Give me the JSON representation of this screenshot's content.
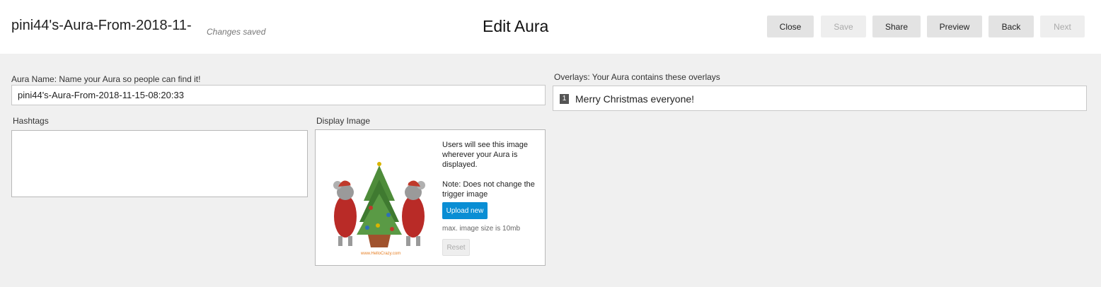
{
  "header": {
    "aura_title": "pini44's-Aura-From-2018-11-",
    "save_status": "Changes saved",
    "page_title": "Edit Aura",
    "buttons": {
      "close": "Close",
      "save": "Save",
      "share": "Share",
      "preview": "Preview",
      "back": "Back",
      "next": "Next"
    }
  },
  "form": {
    "aura_name_label": "Aura Name: Name your Aura so people can find it!",
    "aura_name_value": "pini44's-Aura-From-2018-11-15-08:20:33",
    "hashtags_label": "Hashtags",
    "hashtags_value": "",
    "display_image": {
      "label": "Display Image",
      "note_1": "Users will see this image wherever your Aura is displayed.",
      "note_2": "Note: Does not change the trigger image",
      "upload_label": "Upload new",
      "max_size": "max. image size is 10mb",
      "reset_label": "Reset",
      "image_icon": "christmas-mice-tree-image",
      "image_caption": "www.HelloCrazy.com"
    }
  },
  "overlays": {
    "label": "Overlays: Your Aura contains these overlays",
    "items": [
      {
        "index": "1",
        "label": "Merry Christmas everyone!"
      }
    ]
  },
  "colors": {
    "accent": "#0a8ed4",
    "page_background": "#f0f0f0",
    "header_background": "#ffffff",
    "button_background": "#e3e3e3"
  }
}
